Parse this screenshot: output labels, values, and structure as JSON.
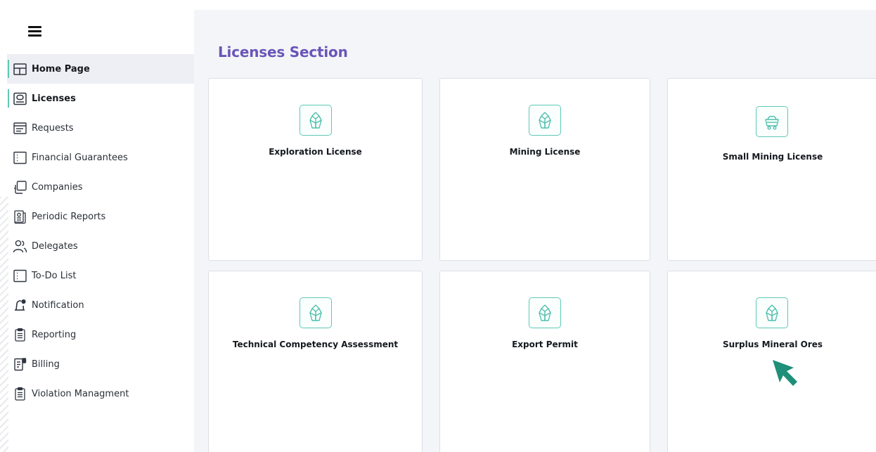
{
  "sidebar": {
    "items": [
      {
        "label": "Home Page",
        "icon": "layout-icon"
      },
      {
        "label": "Licenses",
        "icon": "id-card-icon"
      },
      {
        "label": "Requests",
        "icon": "list-icon"
      },
      {
        "label": "Financial Guarantees",
        "icon": "bracket-icon"
      },
      {
        "label": "Companies",
        "icon": "copy-icon"
      },
      {
        "label": "Periodic Reports",
        "icon": "report-icon"
      },
      {
        "label": "Delegates",
        "icon": "users-icon"
      },
      {
        "label": "To-Do List",
        "icon": "bracket-icon"
      },
      {
        "label": "Notification",
        "icon": "bell-icon"
      },
      {
        "label": "Reporting",
        "icon": "clipboard-icon"
      },
      {
        "label": "Billing",
        "icon": "invoice-icon"
      },
      {
        "label": "Violation Managment",
        "icon": "clipboard-icon"
      }
    ]
  },
  "main": {
    "title": "Licenses Section",
    "cards": [
      {
        "label": "Exploration License",
        "icon": "crystal-icon"
      },
      {
        "label": "Mining License",
        "icon": "crystal-icon"
      },
      {
        "label": "Small Mining License",
        "icon": "mine-cart-icon"
      },
      {
        "label": "Technical Competency Assessment",
        "icon": "crystal-icon"
      },
      {
        "label": "Export Permit",
        "icon": "crystal-icon"
      },
      {
        "label": "Surplus Mineral Ores",
        "icon": "crystal-icon"
      }
    ]
  },
  "colors": {
    "accent": "#5fc8b6",
    "title": "#6a55b8",
    "cursor": "#1e8f78"
  }
}
